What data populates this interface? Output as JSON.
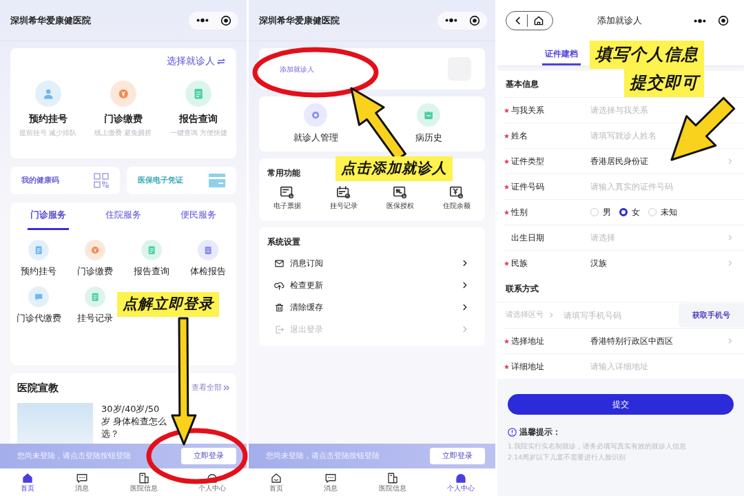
{
  "home_screen": {
    "title": "深圳希华爱康健医院",
    "patient_select": "选择就诊人",
    "quick_services": [
      {
        "label": "预约挂号",
        "subtitle": "提前挂号 减少排队",
        "kind": "person",
        "color": "#6fb6f0"
      },
      {
        "label": "门诊缴费",
        "subtitle": "线上缴费 避免拥挤",
        "kind": "coin",
        "color": "#f08a4b"
      },
      {
        "label": "报告查询",
        "subtitle": "一键查询 方便快捷",
        "kind": "document",
        "color": "#4fcfa0"
      }
    ],
    "shortcuts": [
      {
        "label": "我的健康码",
        "kind": "qr"
      },
      {
        "label": "医保电子凭证",
        "kind": "card"
      }
    ],
    "tabs": [
      {
        "label": "门诊服务",
        "selected": true
      },
      {
        "label": "住院服务",
        "selected": false
      },
      {
        "label": "便民服务",
        "selected": false
      }
    ],
    "services": [
      {
        "label": "预约挂号",
        "kind": "document",
        "color": "#6fb6f0"
      },
      {
        "label": "门诊缴费",
        "kind": "coin",
        "color": "#f08a4b"
      },
      {
        "label": "报告查询",
        "kind": "document",
        "color": "#4fcfa0"
      },
      {
        "label": "体检报告",
        "kind": "clipboard",
        "color": "#8a8ff0"
      },
      {
        "label": "门诊代缴费",
        "kind": "bubble",
        "color": "#6fb6f0"
      },
      {
        "label": "挂号记录",
        "kind": "document",
        "color": "#4fcfa0"
      }
    ],
    "news": {
      "title": "医院宣教",
      "more": "查看全部",
      "articles": [
        {
          "title": "30岁/40岁/50岁 身体检查怎么选？"
        }
      ]
    },
    "login_bar": {
      "message": "您尚未登陆，请点击登陆按钮登陆",
      "button": "立即登录"
    },
    "nav": [
      {
        "label": "首页",
        "kind": "home",
        "selected": true
      },
      {
        "label": "消息",
        "kind": "message",
        "selected": false
      },
      {
        "label": "医院信息",
        "kind": "building",
        "selected": false
      },
      {
        "label": "个人中心",
        "kind": "profile",
        "selected": false
      }
    ]
  },
  "profile_screen": {
    "title": "深圳希华爱康健医院",
    "add_patient": "添加就诊人",
    "patient_actions": [
      {
        "label": "就诊人管理",
        "kind": "gear",
        "color": "#8a8ff0"
      },
      {
        "label": "病历史",
        "kind": "calendar",
        "color": "#4fcfa0"
      }
    ],
    "common": {
      "title": "常用功能",
      "items": [
        {
          "label": "电子票据",
          "kind": "receipt"
        },
        {
          "label": "挂号记录",
          "kind": "ticket"
        },
        {
          "label": "医保授权",
          "kind": "insurance"
        },
        {
          "label": "住院余额",
          "kind": "wallet"
        }
      ]
    },
    "settings": {
      "title": "系统设置",
      "items": [
        {
          "label": "消息订阅",
          "kind": "mail",
          "disabled": false
        },
        {
          "label": "检查更新",
          "kind": "upload",
          "disabled": false
        },
        {
          "label": "清除缓存",
          "kind": "trash",
          "disabled": false
        },
        {
          "label": "退出登录",
          "kind": "logout",
          "disabled": true
        }
      ]
    },
    "login_bar": {
      "message": "您尚未登陆，请点击登陆按钮登陆",
      "button": "立即登录"
    },
    "nav": [
      {
        "label": "首页",
        "kind": "home",
        "selected": false
      },
      {
        "label": "消息",
        "kind": "message",
        "selected": false
      },
      {
        "label": "医院信息",
        "kind": "building",
        "selected": false
      },
      {
        "label": "个人中心",
        "kind": "profile",
        "selected": true
      }
    ]
  },
  "add_patient_screen": {
    "title": "添加就诊人",
    "tabs": [
      {
        "label": "证件建档",
        "selected": true
      }
    ],
    "basic": {
      "title": "基本信息",
      "fields": [
        {
          "label": "与我关系",
          "required": true,
          "kind": "select",
          "placeholder": "请选择与我关系"
        },
        {
          "label": "姓名",
          "required": true,
          "kind": "input",
          "placeholder": "请填写就诊人姓名"
        },
        {
          "label": "证件类型",
          "required": true,
          "kind": "select",
          "value": "香港居民身份证"
        },
        {
          "label": "证件号码",
          "required": true,
          "kind": "input",
          "placeholder": "请输入真实的证件号码"
        },
        {
          "label": "性别",
          "required": true,
          "kind": "radio",
          "options": [
            {
              "label": "男",
              "selected": false
            },
            {
              "label": "女",
              "selected": true
            },
            {
              "label": "未知",
              "selected": false
            }
          ]
        },
        {
          "label": "出生日期",
          "required": false,
          "kind": "select",
          "placeholder": "请选择"
        },
        {
          "label": "民族",
          "required": true,
          "kind": "select",
          "value": "汉族"
        }
      ]
    },
    "contact": {
      "title": "联系方式",
      "phone": {
        "area_placeholder": "请选择区号",
        "placeholder": "请填写手机号码",
        "button": "获取手机号"
      },
      "fields": [
        {
          "label": "选择地址",
          "required": true,
          "kind": "select",
          "value": "香港特别行政区中西区"
        },
        {
          "label": "详细地址",
          "required": true,
          "kind": "input",
          "placeholder": "请输入详细地址"
        }
      ]
    },
    "submit": "提交",
    "tips": {
      "title": "温馨提示：",
      "lines": [
        "1.我院实行实名制就诊，请务必填写真实有效的就诊人信息",
        "2.14周岁以下儿童不需要进行人脸识别"
      ]
    }
  },
  "annotations": [
    {
      "lines": [
        "点解立即登录"
      ]
    },
    {
      "lines": [
        "点击添加就诊人"
      ]
    },
    {
      "lines": [
        "填写个人信息",
        "提交即可"
      ]
    }
  ]
}
